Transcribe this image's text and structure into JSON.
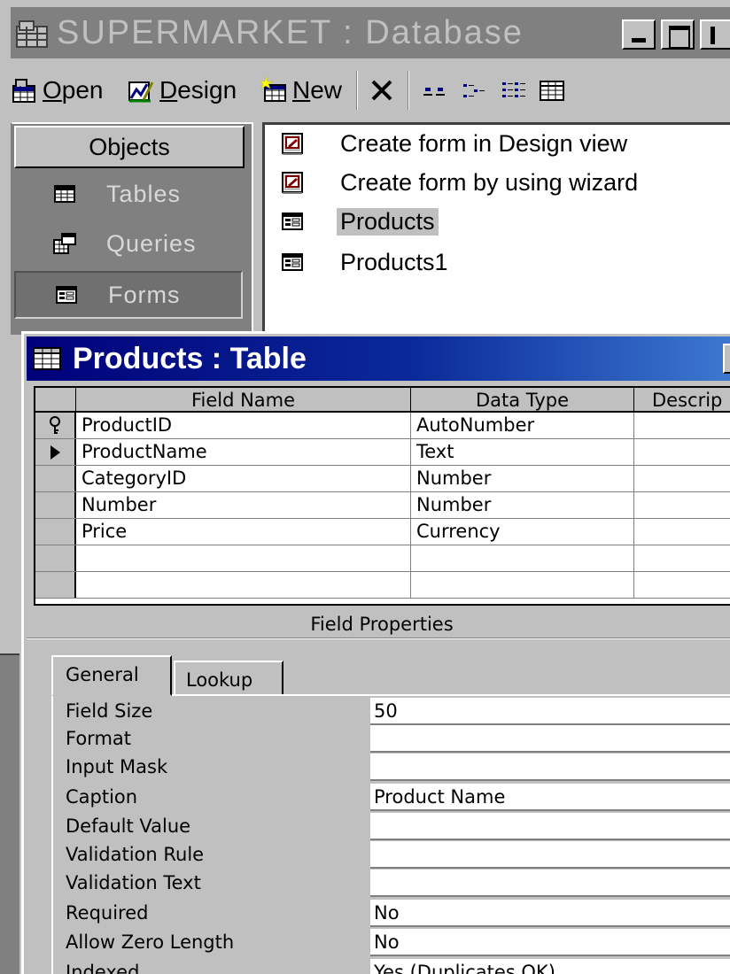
{
  "db_window": {
    "title": "SUPERMARKET : Database",
    "title_icon": "database-icon"
  },
  "toolbar": {
    "open_label": "Open",
    "open_accel": "O",
    "design_label": "Design",
    "design_accel": "D",
    "new_label": "New",
    "new_accel": "N",
    "items": [
      "open-icon",
      "design-icon",
      "new-icon",
      "delete-icon",
      "large-icons-icon",
      "small-icons-icon",
      "list-view-icon",
      "details-view-icon"
    ]
  },
  "objects": {
    "header": "Objects",
    "items": [
      {
        "label": "Tables",
        "icon": "table-icon"
      },
      {
        "label": "Queries",
        "icon": "query-icon"
      },
      {
        "label": "Forms",
        "icon": "form-icon",
        "selected": true
      }
    ]
  },
  "list": {
    "items": [
      {
        "label": "Create form in Design view",
        "icon": "create-form-design-icon"
      },
      {
        "label": "Create form by using wizard",
        "icon": "create-form-wizard-icon"
      },
      {
        "label": "Products",
        "icon": "form-icon",
        "selected": true
      },
      {
        "label": "Products1",
        "icon": "form-icon"
      }
    ]
  },
  "table_window": {
    "title": "Products : Table",
    "columns": {
      "field_name": "Field Name",
      "data_type": "Data Type",
      "description": "Descrip"
    },
    "rows": [
      {
        "marker": "key",
        "field_name": "ProductID",
        "data_type": "AutoNumber"
      },
      {
        "marker": "current",
        "field_name": "ProductName",
        "data_type": "Text"
      },
      {
        "marker": "",
        "field_name": "CategoryID",
        "data_type": "Number"
      },
      {
        "marker": "",
        "field_name": "Number",
        "data_type": "Number"
      },
      {
        "marker": "",
        "field_name": "Price",
        "data_type": "Currency"
      },
      {
        "marker": "",
        "field_name": "",
        "data_type": ""
      },
      {
        "marker": "",
        "field_name": "",
        "data_type": ""
      }
    ],
    "field_properties_label": "Field Properties",
    "tabs": {
      "general": "General",
      "lookup": "Lookup"
    },
    "properties": [
      {
        "label": "Field Size",
        "value": "50"
      },
      {
        "label": "Format",
        "value": ""
      },
      {
        "label": "Input Mask",
        "value": ""
      },
      {
        "label": "Caption",
        "value": "Product Name"
      },
      {
        "label": "Default Value",
        "value": ""
      },
      {
        "label": "Validation Rule",
        "value": ""
      },
      {
        "label": "Validation Text",
        "value": ""
      },
      {
        "label": "Required",
        "value": "No"
      },
      {
        "label": "Allow Zero Length",
        "value": "No"
      },
      {
        "label": "Indexed",
        "value": "Yes (Duplicates OK)"
      }
    ]
  }
}
